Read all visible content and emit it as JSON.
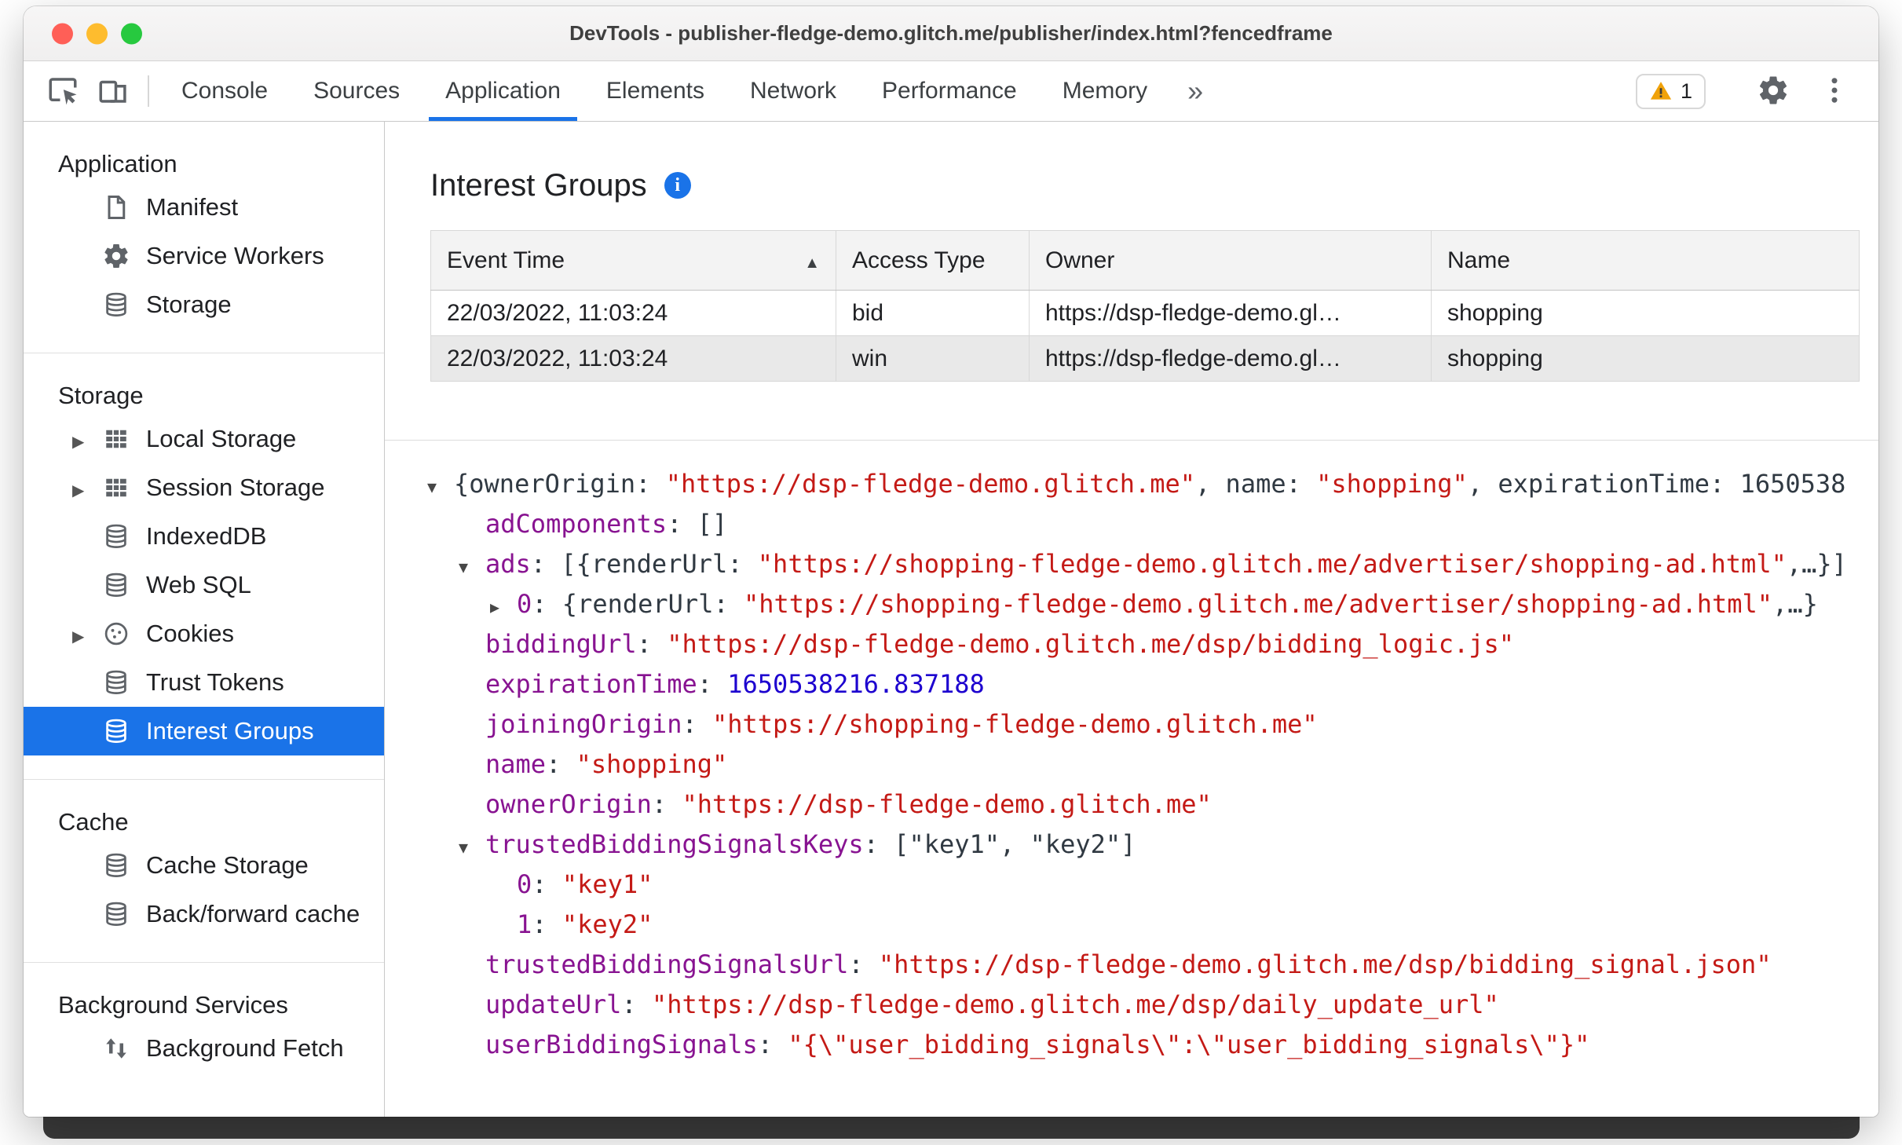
{
  "colors": {
    "accent_blue": "#1a73e8",
    "sidebar_selection": "#1a73e8",
    "json_key_purple": "#881391",
    "json_string_red": "#c41a16",
    "json_number_blue": "#1c00cf",
    "warning_yellow": "#f0a20a",
    "traffic_close": "#ff5f57",
    "traffic_minimize": "#febc2e",
    "traffic_zoom": "#27c93f"
  },
  "window": {
    "title": "DevTools - publisher-fledge-demo.glitch.me/publisher/index.html?fencedframe"
  },
  "toolbar": {
    "tabs": [
      {
        "label": "Console"
      },
      {
        "label": "Sources"
      },
      {
        "label": "Application",
        "active": true
      },
      {
        "label": "Elements"
      },
      {
        "label": "Network"
      },
      {
        "label": "Performance"
      },
      {
        "label": "Memory"
      }
    ],
    "more_tabs_label": "»",
    "warning_count": "1"
  },
  "sidebar": {
    "sections": [
      {
        "header": "Application",
        "items": [
          {
            "label": "Manifest",
            "icon": "manifest"
          },
          {
            "label": "Service Workers",
            "icon": "gear"
          },
          {
            "label": "Storage",
            "icon": "database"
          }
        ]
      },
      {
        "header": "Storage",
        "items": [
          {
            "label": "Local Storage",
            "icon": "table",
            "arrow": true
          },
          {
            "label": "Session Storage",
            "icon": "table",
            "arrow": true
          },
          {
            "label": "IndexedDB",
            "icon": "database"
          },
          {
            "label": "Web SQL",
            "icon": "database"
          },
          {
            "label": "Cookies",
            "icon": "cookie",
            "arrow": true
          },
          {
            "label": "Trust Tokens",
            "icon": "database"
          },
          {
            "label": "Interest Groups",
            "icon": "database",
            "selected": true
          }
        ]
      },
      {
        "header": "Cache",
        "items": [
          {
            "label": "Cache Storage",
            "icon": "database"
          },
          {
            "label": "Back/forward cache",
            "icon": "database"
          }
        ]
      },
      {
        "header": "Background Services",
        "items": [
          {
            "label": "Background Fetch",
            "icon": "fetch"
          }
        ]
      }
    ]
  },
  "main": {
    "title": "Interest Groups",
    "table": {
      "columns": [
        {
          "label": "Event Time",
          "sorted": "asc"
        },
        {
          "label": "Access Type"
        },
        {
          "label": "Owner"
        },
        {
          "label": "Name"
        }
      ],
      "rows": [
        {
          "cells": [
            "22/03/2022, 11:03:24",
            "bid",
            "https://dsp-fledge-demo.gl…",
            "shopping"
          ],
          "selected": false
        },
        {
          "cells": [
            "22/03/2022, 11:03:24",
            "win",
            "https://dsp-fledge-demo.gl…",
            "shopping"
          ],
          "selected": true
        }
      ]
    },
    "tree": {
      "lines": [
        {
          "indent": 0,
          "expander": "down",
          "segments": [
            {
              "type": "plain",
              "text": "{ownerOrigin: "
            },
            {
              "type": "string",
              "text": "\"https://dsp-fledge-demo.glitch.me\""
            },
            {
              "type": "plain",
              "text": ", name: "
            },
            {
              "type": "string",
              "text": "\"shopping\""
            },
            {
              "type": "plain",
              "text": ", expirationTime: 1650538"
            }
          ]
        },
        {
          "indent": 1,
          "expander": null,
          "segments": [
            {
              "type": "key",
              "text": "adComponents"
            },
            {
              "type": "plain",
              "text": ": []"
            }
          ]
        },
        {
          "indent": 1,
          "expander": "down",
          "segments": [
            {
              "type": "key",
              "text": "ads"
            },
            {
              "type": "plain",
              "text": ": [{renderUrl: "
            },
            {
              "type": "string",
              "text": "\"https://shopping-fledge-demo.glitch.me/advertiser/shopping-ad.html\""
            },
            {
              "type": "plain",
              "text": ",…}]"
            }
          ]
        },
        {
          "indent": 2,
          "expander": "right",
          "segments": [
            {
              "type": "key",
              "text": "0"
            },
            {
              "type": "plain",
              "text": ": {renderUrl: "
            },
            {
              "type": "string",
              "text": "\"https://shopping-fledge-demo.glitch.me/advertiser/shopping-ad.html\""
            },
            {
              "type": "plain",
              "text": ",…}"
            }
          ]
        },
        {
          "indent": 1,
          "expander": null,
          "segments": [
            {
              "type": "key",
              "text": "biddingUrl"
            },
            {
              "type": "plain",
              "text": ": "
            },
            {
              "type": "string",
              "text": "\"https://dsp-fledge-demo.glitch.me/dsp/bidding_logic.js\""
            }
          ]
        },
        {
          "indent": 1,
          "expander": null,
          "segments": [
            {
              "type": "key",
              "text": "expirationTime"
            },
            {
              "type": "plain",
              "text": ": "
            },
            {
              "type": "number",
              "text": "1650538216.837188"
            }
          ]
        },
        {
          "indent": 1,
          "expander": null,
          "segments": [
            {
              "type": "key",
              "text": "joiningOrigin"
            },
            {
              "type": "plain",
              "text": ": "
            },
            {
              "type": "string",
              "text": "\"https://shopping-fledge-demo.glitch.me\""
            }
          ]
        },
        {
          "indent": 1,
          "expander": null,
          "segments": [
            {
              "type": "key",
              "text": "name"
            },
            {
              "type": "plain",
              "text": ": "
            },
            {
              "type": "string",
              "text": "\"shopping\""
            }
          ]
        },
        {
          "indent": 1,
          "expander": null,
          "segments": [
            {
              "type": "key",
              "text": "ownerOrigin"
            },
            {
              "type": "plain",
              "text": ": "
            },
            {
              "type": "string",
              "text": "\"https://dsp-fledge-demo.glitch.me\""
            }
          ]
        },
        {
          "indent": 1,
          "expander": "down",
          "segments": [
            {
              "type": "key",
              "text": "trustedBiddingSignalsKeys"
            },
            {
              "type": "plain",
              "text": ": [\"key1\", \"key2\"]"
            }
          ]
        },
        {
          "indent": 2,
          "expander": null,
          "segments": [
            {
              "type": "key",
              "text": "0"
            },
            {
              "type": "plain",
              "text": ": "
            },
            {
              "type": "string",
              "text": "\"key1\""
            }
          ]
        },
        {
          "indent": 2,
          "expander": null,
          "segments": [
            {
              "type": "key",
              "text": "1"
            },
            {
              "type": "plain",
              "text": ": "
            },
            {
              "type": "string",
              "text": "\"key2\""
            }
          ]
        },
        {
          "indent": 1,
          "expander": null,
          "segments": [
            {
              "type": "key",
              "text": "trustedBiddingSignalsUrl"
            },
            {
              "type": "plain",
              "text": ": "
            },
            {
              "type": "string",
              "text": "\"https://dsp-fledge-demo.glitch.me/dsp/bidding_signal.json\""
            }
          ]
        },
        {
          "indent": 1,
          "expander": null,
          "segments": [
            {
              "type": "key",
              "text": "updateUrl"
            },
            {
              "type": "plain",
              "text": ": "
            },
            {
              "type": "string",
              "text": "\"https://dsp-fledge-demo.glitch.me/dsp/daily_update_url\""
            }
          ]
        },
        {
          "indent": 1,
          "expander": null,
          "segments": [
            {
              "type": "key",
              "text": "userBiddingSignals"
            },
            {
              "type": "plain",
              "text": ": "
            },
            {
              "type": "string",
              "text": "\"{\\\"user_bidding_signals\\\":\\\"user_bidding_signals\\\"}\""
            }
          ]
        }
      ]
    }
  }
}
